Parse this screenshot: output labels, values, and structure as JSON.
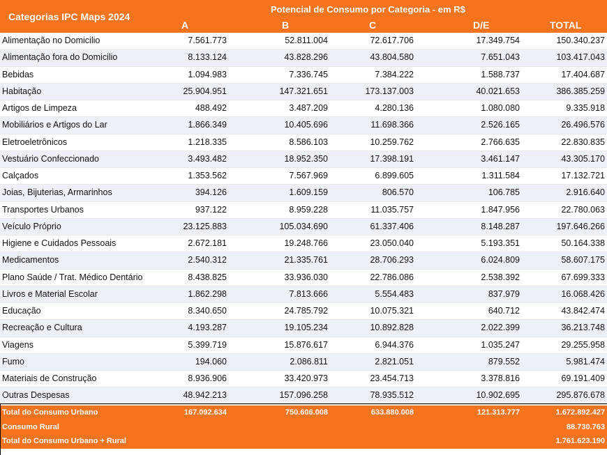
{
  "header": {
    "categories_label": "Categorias IPC Maps 2024",
    "super_header": "Potencial de Consumo por Categoria   -   em R$",
    "columns": [
      "A",
      "B",
      "C",
      "D/E",
      "TOTAL"
    ]
  },
  "rows": [
    {
      "label": "Alimentação no Domicilio",
      "values": [
        "7.561.773",
        "52.811.004",
        "72.617.706",
        "17.349.754",
        "150.340.237"
      ]
    },
    {
      "label": "Alimentação fora do Domicilio",
      "values": [
        "8.133.124",
        "43.828.296",
        "43.804.580",
        "7.651.043",
        "103.417.043"
      ]
    },
    {
      "label": "Bebidas",
      "values": [
        "1.094.983",
        "7.336.745",
        "7.384.222",
        "1.588.737",
        "17.404.687"
      ]
    },
    {
      "label": "Habitação",
      "values": [
        "25.904.951",
        "147.321.651",
        "173.137.003",
        "40.021.653",
        "386.385.259"
      ]
    },
    {
      "label": "Artigos de Limpeza",
      "values": [
        "488.492",
        "3.487.209",
        "4.280.136",
        "1.080.080",
        "9.335.918"
      ]
    },
    {
      "label": "Mobiliários e Artigos do Lar",
      "values": [
        "1.866.349",
        "10.405.696",
        "11.698.366",
        "2.526.165",
        "26.496.576"
      ]
    },
    {
      "label": "Eletroeletrônicos",
      "values": [
        "1.218.335",
        "8.586.103",
        "10.259.762",
        "2.766.635",
        "22.830.835"
      ]
    },
    {
      "label": "Vestuário Confeccionado",
      "values": [
        "3.493.482",
        "18.952.350",
        "17.398.191",
        "3.461.147",
        "43.305.170"
      ]
    },
    {
      "label": "Calçados",
      "values": [
        "1.353.562",
        "7.567.969",
        "6.899.605",
        "1.311.584",
        "17.132.721"
      ]
    },
    {
      "label": "Joias, Bijuterias, Armarinhos",
      "values": [
        "394.126",
        "1.609.159",
        "806.570",
        "106.785",
        "2.916.640"
      ]
    },
    {
      "label": "Transportes Urbanos",
      "values": [
        "937.122",
        "8.959.228",
        "11.035.757",
        "1.847.956",
        "22.780.063"
      ]
    },
    {
      "label": "Veículo Próprio",
      "values": [
        "23.125.883",
        "105.034.690",
        "61.337.406",
        "8.148.287",
        "197.646.266"
      ]
    },
    {
      "label": "Higiene e Cuidados Pessoais",
      "values": [
        "2.672.181",
        "19.248.766",
        "23.050.040",
        "5.193.351",
        "50.164.338"
      ]
    },
    {
      "label": "Medicamentos",
      "values": [
        "2.540.312",
        "21.335.761",
        "28.706.293",
        "6.024.809",
        "58.607.175"
      ]
    },
    {
      "label": "Plano Saúde / Trat. Médico Dentário",
      "values": [
        "8.438.825",
        "33.936.030",
        "22.786.086",
        "2.538.392",
        "67.699.333"
      ]
    },
    {
      "label": "Livros e Material Escolar",
      "values": [
        "1.862.298",
        "7.813.666",
        "5.554.483",
        "837.979",
        "16.068.426"
      ]
    },
    {
      "label": "Educação",
      "values": [
        "8.340.650",
        "24.785.792",
        "10.075.321",
        "640.712",
        "43.842.474"
      ]
    },
    {
      "label": "Recreação e Cultura",
      "values": [
        "4.193.287",
        "19.105.234",
        "10.892.828",
        "2.022.399",
        "36.213.748"
      ]
    },
    {
      "label": "Viagens",
      "values": [
        "5.399.719",
        "15.876.617",
        "6.944.376",
        "1.035.247",
        "29.255.958"
      ]
    },
    {
      "label": "Fumo",
      "values": [
        "194.060",
        "2.086.811",
        "2.821.051",
        "879.552",
        "5.981.474"
      ]
    },
    {
      "label": "Materiais de Construção",
      "values": [
        "8.936.906",
        "33.420.973",
        "23.454.713",
        "3.378.816",
        "69.191.409"
      ]
    },
    {
      "label": "Outras Despesas",
      "values": [
        "48.942.213",
        "157.096.258",
        "78.935.512",
        "10.902.695",
        "295.876.678"
      ]
    }
  ],
  "totals": [
    {
      "label": "Total do Consumo Urbano",
      "values": [
        "167.092.634",
        "750.606.008",
        "633.880.008",
        "121.313.777",
        "1.672.892.427"
      ]
    },
    {
      "label": "Consumo Rural",
      "values": [
        "",
        "",
        "",
        "",
        "88.730.763"
      ]
    },
    {
      "label": "Total do Consumo Urbano + Rural",
      "values": [
        "",
        "",
        "",
        "",
        "1.761.623.190"
      ]
    }
  ]
}
